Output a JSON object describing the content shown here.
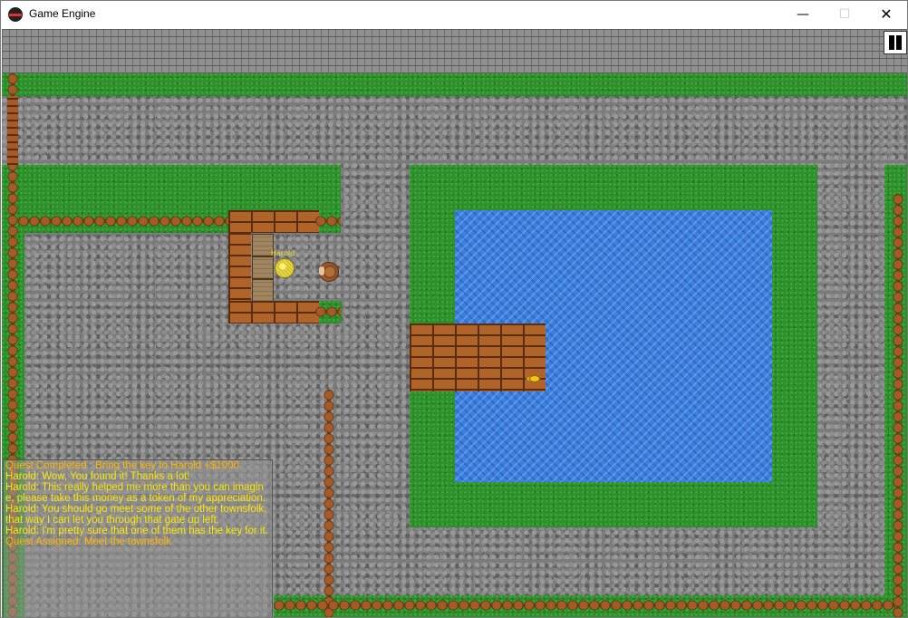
{
  "window": {
    "title": "Game Engine",
    "minimize_glyph": "—",
    "maximize_glyph": "☐",
    "close_glyph": "✕"
  },
  "game": {
    "npc_name": "Harold",
    "pause_icon": "pause-icon",
    "item_icon": "fish-icon"
  },
  "chat": {
    "lines": [
      {
        "text": "Quest Completed : Bring the key to Harold +$1000",
        "type": "quest"
      },
      {
        "text": "Harold: Wow, You found it! Thanks a lot!",
        "type": "dialogue"
      },
      {
        "text": "Harold: This really helped me more than you can imagine, please take this money as a token of my appreciation.",
        "type": "dialogue"
      },
      {
        "text": "Harold: You should go meet some of the other townsfolk, that way I can let you through that gate up left.",
        "type": "dialogue"
      },
      {
        "text": "Harold: I'm pretty sure that one of them has the key for it.",
        "type": "dialogue"
      },
      {
        "text": "Quest Assigned: Meet the townsfolk",
        "type": "quest"
      }
    ]
  },
  "colors": {
    "chat_text": "#ffe600",
    "quest_text": "#ffb400",
    "grass": "#2e8f2c",
    "water": "#3a80e0",
    "wood": "#b0642a",
    "cobblestone": "#7b7b7b"
  }
}
